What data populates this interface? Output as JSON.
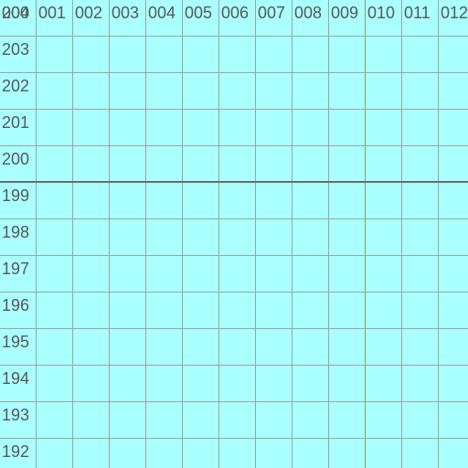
{
  "grid": {
    "background": "#aaffff",
    "line_color": "#9aa79a",
    "columns": [
      "000",
      "001",
      "002",
      "003",
      "004",
      "005",
      "006",
      "007",
      "008",
      "009",
      "010",
      "011",
      "012"
    ],
    "rows": [
      "204",
      "203",
      "202",
      "201",
      "200",
      "199",
      "198",
      "197",
      "196",
      "195",
      "194",
      "193",
      "192"
    ]
  }
}
